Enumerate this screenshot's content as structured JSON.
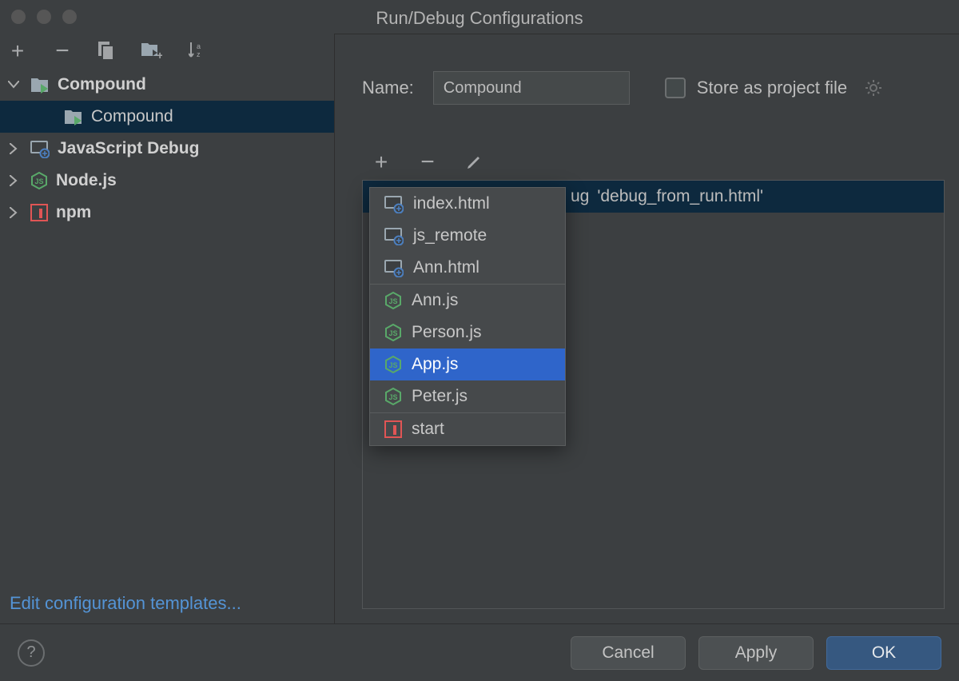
{
  "window": {
    "title": "Run/Debug Configurations"
  },
  "left_toolbar": {
    "add": "+",
    "remove": "−",
    "copy": "copy",
    "save": "save",
    "sort": "sort"
  },
  "tree": [
    {
      "label": "Compound",
      "icon": "folder-run",
      "expanded": true,
      "bold": true,
      "children": [
        {
          "label": "Compound",
          "icon": "folder-run",
          "selected": true
        }
      ]
    },
    {
      "label": "JavaScript Debug",
      "icon": "js-debug",
      "bold": true
    },
    {
      "label": "Node.js",
      "icon": "nodejs",
      "bold": true
    },
    {
      "label": "npm",
      "icon": "npm",
      "bold": true
    }
  ],
  "edit_templates": "Edit configuration templates...",
  "form": {
    "name_label": "Name:",
    "name_value": "Compound",
    "store_label": "Store as project file"
  },
  "listing": {
    "row_prefix": "ug ",
    "row_text": "'debug_from_run.html'"
  },
  "popup": {
    "groups": [
      [
        {
          "label": "index.html",
          "icon": "js-debug"
        },
        {
          "label": "js_remote",
          "icon": "js-debug"
        },
        {
          "label": "Ann.html",
          "icon": "js-debug"
        }
      ],
      [
        {
          "label": "Ann.js",
          "icon": "nodejs"
        },
        {
          "label": "Person.js",
          "icon": "nodejs"
        },
        {
          "label": "App.js",
          "icon": "nodejs",
          "selected": true
        },
        {
          "label": "Peter.js",
          "icon": "nodejs"
        }
      ],
      [
        {
          "label": "start",
          "icon": "npm"
        }
      ]
    ]
  },
  "buttons": {
    "cancel": "Cancel",
    "apply": "Apply",
    "ok": "OK"
  }
}
